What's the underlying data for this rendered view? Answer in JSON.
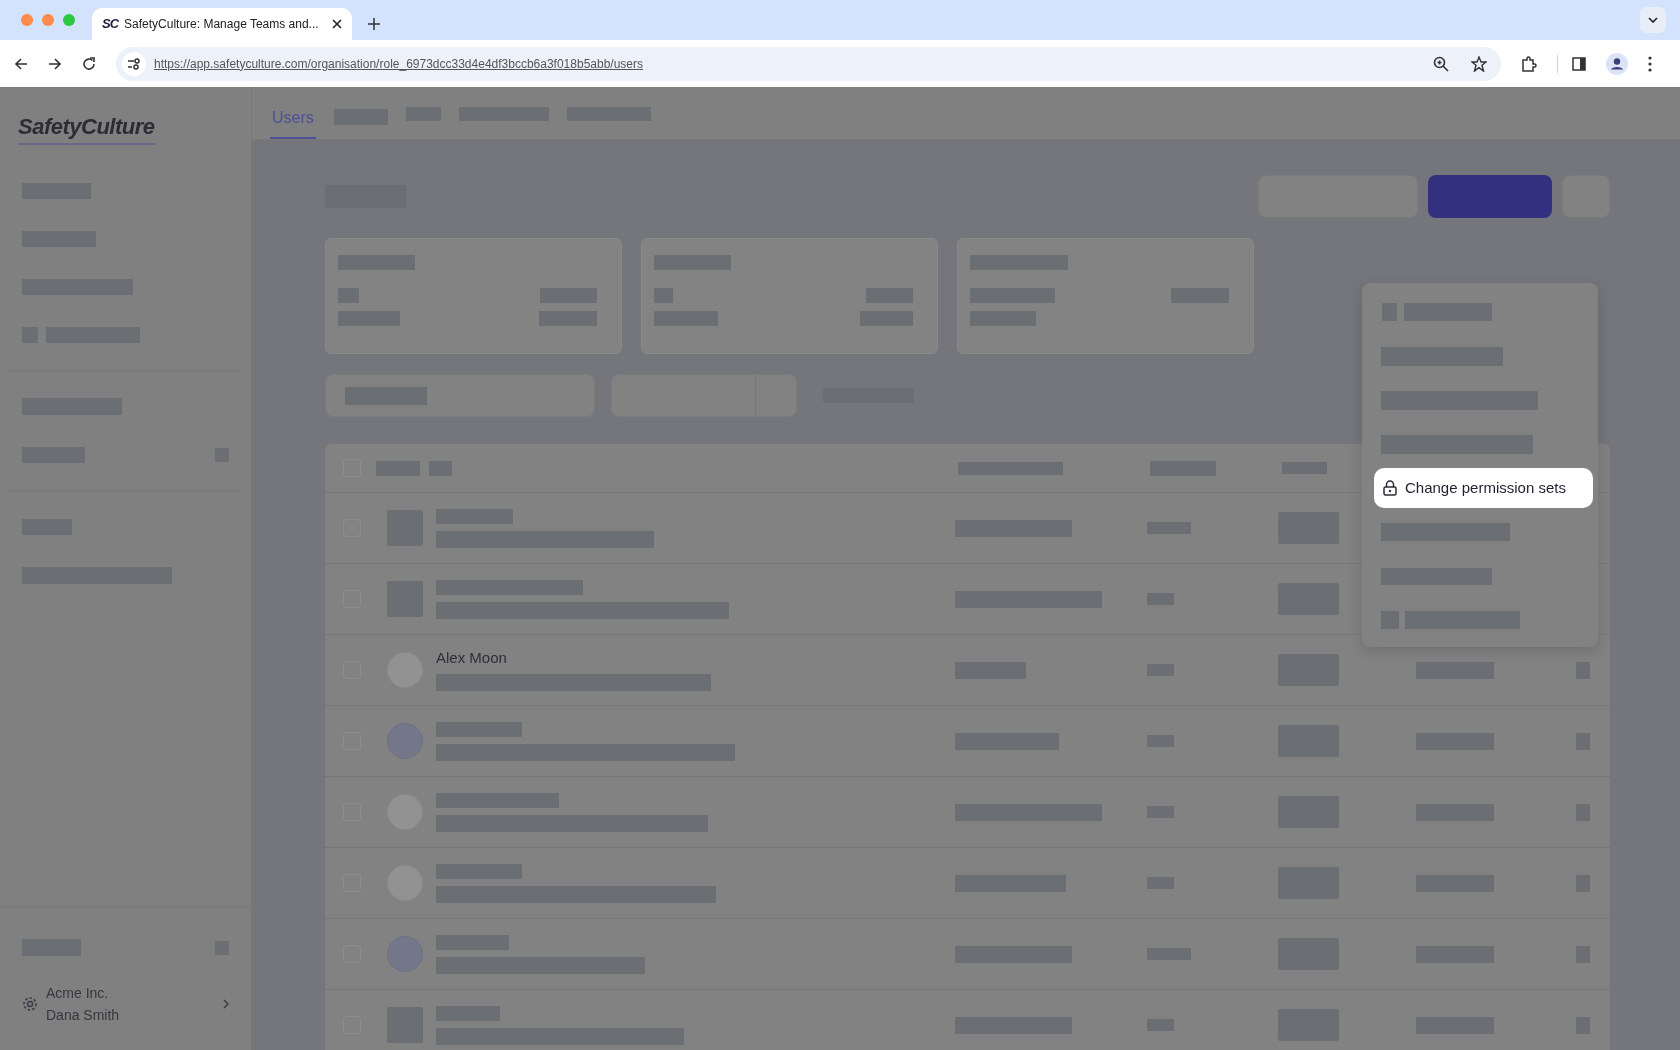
{
  "browser": {
    "favicon": "SC",
    "tab_title": "SafetyCulture: Manage Teams and...",
    "url": "https://app.safetyculture.com/organisation/role_6973dcc33d4e4df3bccb6a3f018b5abb/users"
  },
  "logo": "SafetyCulture",
  "tabs": [
    {
      "label": "Users",
      "selected": true
    }
  ],
  "table": {
    "header_checkbox": {
      "checked": false
    },
    "rows": [
      {
        "checked": false
      },
      {
        "checked": false
      },
      {
        "checked": false,
        "name": "Alex Moon"
      },
      {
        "checked": false
      },
      {
        "checked": false
      },
      {
        "checked": false
      },
      {
        "checked": false
      },
      {
        "checked": false
      }
    ]
  },
  "menu": {
    "highlighted_item": {
      "label": "Change permission sets"
    }
  },
  "account": {
    "organisation": "Acme Inc.",
    "user": "Dana Smith"
  }
}
